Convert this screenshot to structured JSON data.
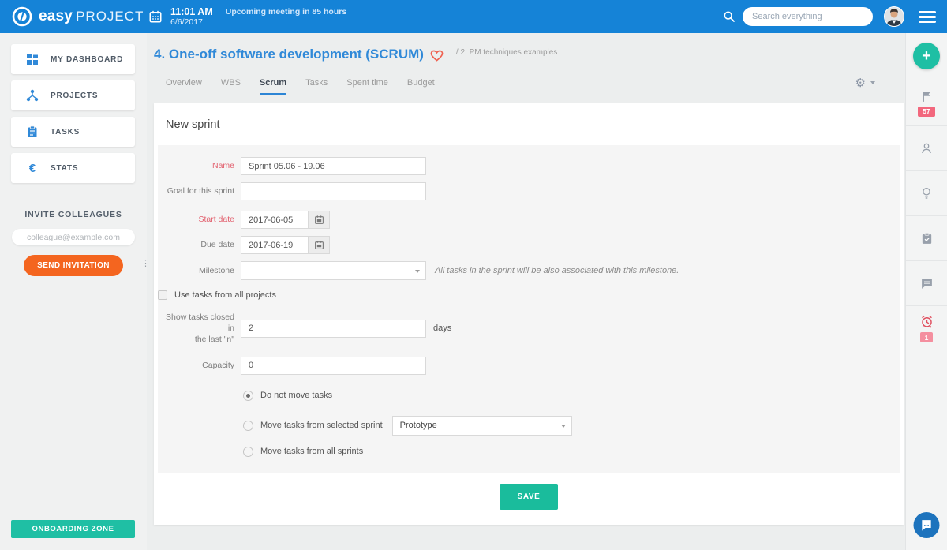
{
  "topbar": {
    "logo_easy": "easy",
    "logo_project": "PROJECT",
    "time": "11:01 AM",
    "date": "6/6/2017",
    "meeting_note": "Upcoming meeting in 85 hours",
    "search_placeholder": "Search everything"
  },
  "sidebar": {
    "items": [
      {
        "label": "MY DASHBOARD"
      },
      {
        "label": "PROJECTS"
      },
      {
        "label": "TASKS"
      },
      {
        "label": "STATS"
      }
    ],
    "invite": {
      "title": "INVITE COLLEAGUES",
      "email_placeholder": "colleague@example.com",
      "send_label": "SEND INVITATION"
    },
    "onboarding_label": "ONBOARDING ZONE"
  },
  "header": {
    "title": "4. One-off software development (SCRUM)",
    "breadcrumb": "/ 2. PM techniques examples",
    "tabs": [
      {
        "label": "Overview",
        "active": false
      },
      {
        "label": "WBS",
        "active": false
      },
      {
        "label": "Scrum",
        "active": true
      },
      {
        "label": "Tasks",
        "active": false
      },
      {
        "label": "Spent time",
        "active": false
      },
      {
        "label": "Budget",
        "active": false
      }
    ]
  },
  "form": {
    "title": "New sprint",
    "name": {
      "label": "Name",
      "value": "Sprint 05.06 - 19.06",
      "required": true
    },
    "goal": {
      "label": "Goal for this sprint",
      "value": ""
    },
    "start_date": {
      "label": "Start date",
      "value": "2017-06-05",
      "required": true
    },
    "due_date": {
      "label": "Due date",
      "value": "2017-06-19"
    },
    "milestone": {
      "label": "Milestone",
      "value": "",
      "note": "All tasks in the sprint will be also associated with this milestone."
    },
    "use_all_projects": {
      "label": "Use tasks from all projects",
      "checked": false
    },
    "closed_days": {
      "label_line1": "Show tasks closed in",
      "label_line2": "the last \"n\"",
      "value": "2",
      "suffix": "days"
    },
    "capacity": {
      "label": "Capacity",
      "value": "0"
    },
    "move_options": [
      {
        "label": "Do not move tasks",
        "selected": true
      },
      {
        "label": "Move tasks from selected sprint",
        "selected": false,
        "dropdown_value": "Prototype"
      },
      {
        "label": "Move tasks from all sprints",
        "selected": false
      }
    ],
    "save_label": "SAVE"
  },
  "right_rail": {
    "flag_badge": "57",
    "alarm_badge": "1"
  },
  "colors": {
    "topbar_blue": "#1583d7",
    "title_blue": "#3089d8",
    "teal_accent": "#1abc9c",
    "orange_accent": "#f4651f",
    "badge_pink": "#f2677d",
    "alarm_red": "#e04f5f"
  }
}
